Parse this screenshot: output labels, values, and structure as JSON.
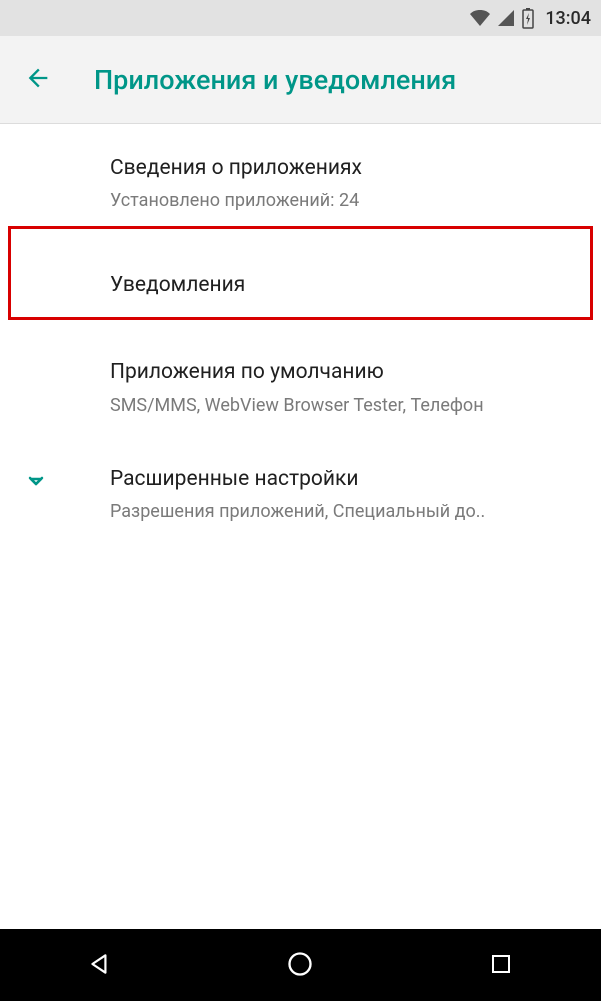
{
  "status_bar": {
    "time": "13:04"
  },
  "header": {
    "title": "Приложения и уведомления"
  },
  "items": {
    "app_info": {
      "title": "Сведения о приложениях",
      "sub": "Установлено приложений: 24"
    },
    "notifications": {
      "title": "Уведомления"
    },
    "default_apps": {
      "title": "Приложения по умолчанию",
      "sub": "SMS/MMS, WebView Browser Tester, Телефон"
    },
    "advanced": {
      "title": "Расширенные настройки",
      "sub": "Разрешения приложений, Специальный до.."
    }
  }
}
